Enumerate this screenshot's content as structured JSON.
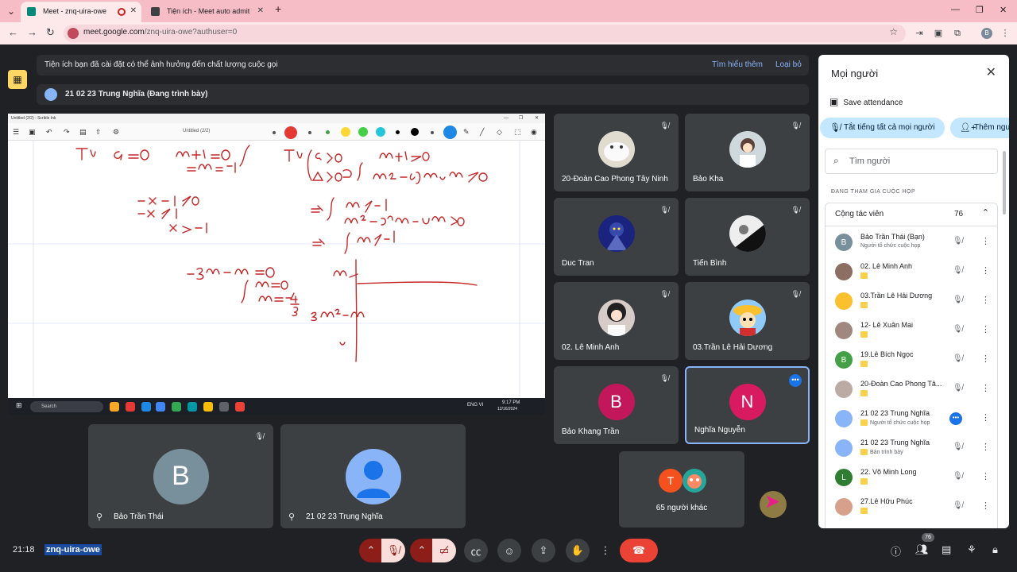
{
  "browser": {
    "tabs": [
      {
        "title": "Meet - znq-uira-owe",
        "active": true
      },
      {
        "title": "Tiện ích - Meet auto admit",
        "active": false
      }
    ],
    "url_host": "meet.google.com",
    "url_path": "/znq-uira-owe?authuser=0",
    "profile_initial": "B"
  },
  "banner": {
    "warning": "Tiện ích bạn đã cài đặt có thể ảnh hưởng đến chất lượng cuộc gọi",
    "learn_more": "Tìm hiểu thêm",
    "dismiss": "Loại bỏ"
  },
  "presenting": {
    "label": "21 02 23 Trung Nghĩa (Đang trình bày)"
  },
  "share": {
    "window_title": "Untitled (2/2) - Scrible Ink",
    "doc_title": "Untitled (2/2)",
    "taskbar_search": "Search",
    "taskbar_lang": "ENG VI",
    "taskbar_time": "9:17 PM",
    "taskbar_date": "12/16/2024",
    "pen_colors": [
      "#e53935",
      "#2e7d32",
      "#fdd835",
      "#43a047",
      "#26c6da",
      "#000000"
    ]
  },
  "tiles": [
    {
      "name": "20-Đoàn Cao Phong Tây Ninh"
    },
    {
      "name": "Bảo Kha"
    },
    {
      "name": "Duc Tran"
    },
    {
      "name": "Tiến Bình"
    },
    {
      "name": "02. Lê Minh Anh"
    },
    {
      "name": "03.Trần Lê Hải Dương"
    },
    {
      "name": "Bảo Khang Trần",
      "initial": "B",
      "color": "#c2185b"
    },
    {
      "name": "Nghĩa Nguyễn",
      "initial": "N",
      "color": "#d81b60"
    }
  ],
  "pinned": [
    {
      "name": "Bảo Trần Thái",
      "initial": "B",
      "color": "#78909c"
    },
    {
      "name": "21 02 23 Trung Nghĩa"
    }
  ],
  "others": {
    "initial": "T",
    "color": "#f4511e",
    "label": "65 người khác"
  },
  "bottom": {
    "time": "21:18",
    "code": "znq-uira-owe",
    "people_count": "76"
  },
  "panel": {
    "title": "Mọi người",
    "save_attendance": "Save attendance",
    "mute_all": "Tắt tiếng tất cả mọi người",
    "add_people": "Thêm ngư",
    "search_placeholder": "Tìm người",
    "section_label": "ĐANG THAM GIA CUỘC HỌP",
    "group_label": "Cộng tác viên",
    "group_count": "76",
    "people": [
      {
        "name": "Bảo Trần Thái (Bạn)",
        "role": "Người tổ chức cuộc họp",
        "initial": "B",
        "color": "#78909c"
      },
      {
        "name": "02. Lê Minh Anh",
        "role": "",
        "initial": "",
        "color": "#8d6e63"
      },
      {
        "name": "03.Trần Lê Hải Dương",
        "role": "",
        "initial": "",
        "color": "#fbc02d"
      },
      {
        "name": "12- Lê Xuân Mai",
        "role": "",
        "initial": "",
        "color": "#a1887f"
      },
      {
        "name": "19.Lê Bích Ngọc",
        "role": "",
        "initial": "B",
        "color": "#43a047"
      },
      {
        "name": "20-Đoàn Cao Phong Tâ...",
        "role": "",
        "initial": "",
        "color": "#bcaaa4"
      },
      {
        "name": "21 02 23 Trung Nghĩa",
        "role": "Người tổ chức cuộc họp",
        "initial": "",
        "color": "#8ab4f8"
      },
      {
        "name": "21 02 23 Trung Nghĩa",
        "role": "Bản trình bày",
        "initial": "",
        "color": "#8ab4f8"
      },
      {
        "name": "22. Võ Minh Long",
        "role": "",
        "initial": "L",
        "color": "#2e7d32"
      },
      {
        "name": "27.Lê Hữu Phúc",
        "role": "",
        "initial": "",
        "color": "#d7a08c"
      }
    ]
  }
}
